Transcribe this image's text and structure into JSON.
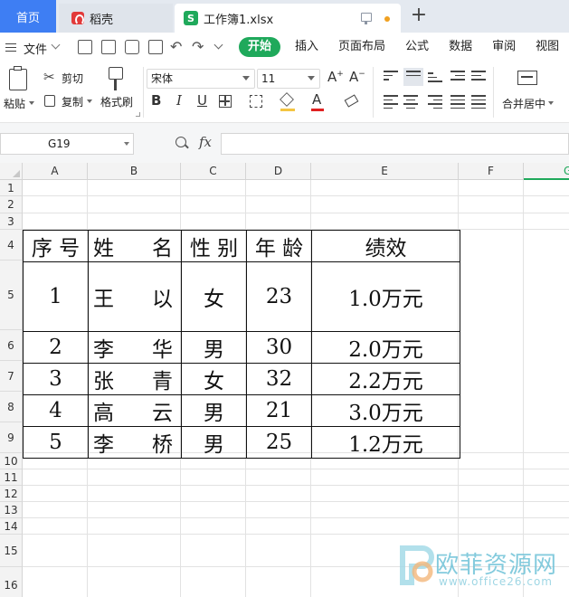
{
  "tabs": {
    "home": "首页",
    "daoke": "稻壳",
    "doc": "工作簿1.xlsx",
    "new_tab": "+"
  },
  "menu": {
    "file": "文件",
    "tabs": [
      "开始",
      "插入",
      "页面布局",
      "公式",
      "数据",
      "审阅",
      "视图"
    ]
  },
  "ribbon": {
    "paste": "粘贴",
    "cut": "剪切",
    "copy": "复制",
    "format_painter": "格式刷",
    "font_name": "宋体",
    "font_size": "11",
    "merge_center": "合并居中"
  },
  "formula_bar": {
    "cell_ref": "G19",
    "fx": "fx",
    "value": ""
  },
  "grid": {
    "columns": [
      "A",
      "B",
      "C",
      "D",
      "E",
      "F",
      "G"
    ],
    "rows": [
      "1",
      "2",
      "3",
      "4",
      "5",
      "6",
      "7",
      "8",
      "9",
      "10",
      "11",
      "12",
      "13",
      "14",
      "15",
      "16"
    ],
    "selected_cell": "G19"
  },
  "table": {
    "headers": {
      "seq": [
        "序",
        "号"
      ],
      "name": [
        "姓",
        "名"
      ],
      "gender": [
        "性",
        "别"
      ],
      "age": [
        "年",
        "龄"
      ],
      "performance": "绩效"
    },
    "rows": [
      {
        "seq": "1",
        "name": [
          "王",
          "以"
        ],
        "gender": "女",
        "age": "23",
        "performance": "1.0万元"
      },
      {
        "seq": "2",
        "name": [
          "李",
          "华"
        ],
        "gender": "男",
        "age": "30",
        "performance": "2.0万元"
      },
      {
        "seq": "3",
        "name": [
          "张",
          "青"
        ],
        "gender": "女",
        "age": "32",
        "performance": "2.2万元"
      },
      {
        "seq": "4",
        "name": [
          "高",
          "云"
        ],
        "gender": "男",
        "age": "21",
        "performance": "3.0万元"
      },
      {
        "seq": "5",
        "name": [
          "李",
          "桥"
        ],
        "gender": "男",
        "age": "25",
        "performance": "1.2万元"
      }
    ]
  },
  "watermark": {
    "name": "欧菲资源网",
    "url": "www.office26.com"
  },
  "colors": {
    "accent_green": "#1fa95b",
    "home_tab_blue": "#3e7ef3",
    "watermark": "#6fc2d8"
  }
}
